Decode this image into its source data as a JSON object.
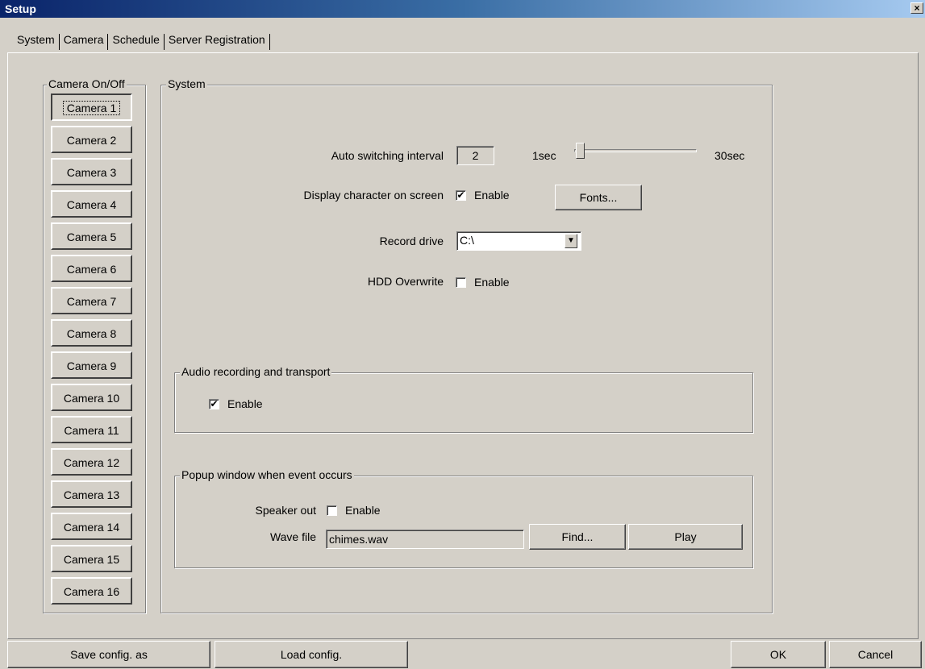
{
  "window": {
    "title": "Setup",
    "close_glyph": "×"
  },
  "tabs": [
    {
      "label": "System",
      "active": true
    },
    {
      "label": "Camera"
    },
    {
      "label": "Schedule"
    },
    {
      "label": "Server Registration"
    }
  ],
  "camera_group": {
    "label": "Camera On/Off",
    "cameras": [
      "Camera 1",
      "Camera 2",
      "Camera 3",
      "Camera 4",
      "Camera 5",
      "Camera 6",
      "Camera 7",
      "Camera 8",
      "Camera 9",
      "Camera 10",
      "Camera 11",
      "Camera 12",
      "Camera 13",
      "Camera 14",
      "Camera 15",
      "Camera 16"
    ]
  },
  "system": {
    "label": "System",
    "auto_switch": {
      "label": "Auto switching interval",
      "value": "2",
      "min_label": "1sec",
      "max_label": "30sec",
      "slider_value": 2
    },
    "display_char": {
      "label": "Display character on screen",
      "checkbox_label": "Enable",
      "checked": true,
      "fonts_button": "Fonts..."
    },
    "record_drive": {
      "label": "Record drive",
      "value": "C:\\"
    },
    "hdd_overwrite": {
      "label": "HDD Overwrite",
      "checkbox_label": "Enable",
      "checked": false
    }
  },
  "audio": {
    "label": "Audio recording and transport",
    "checkbox_label": "Enable",
    "checked": true
  },
  "popup": {
    "label": "Popup window when event occurs",
    "speaker_label": "Speaker out",
    "speaker_checkbox_label": "Enable",
    "speaker_checked": false,
    "wave_label": "Wave file",
    "wave_value": "chimes.wav",
    "find_button": "Find...",
    "play_button": "Play"
  },
  "footer": {
    "save_button": "Save config. as",
    "load_button": "Load config.",
    "ok_button": "OK",
    "cancel_button": "Cancel"
  },
  "glyphs": {
    "check": "✔",
    "dropdown": "▼"
  }
}
